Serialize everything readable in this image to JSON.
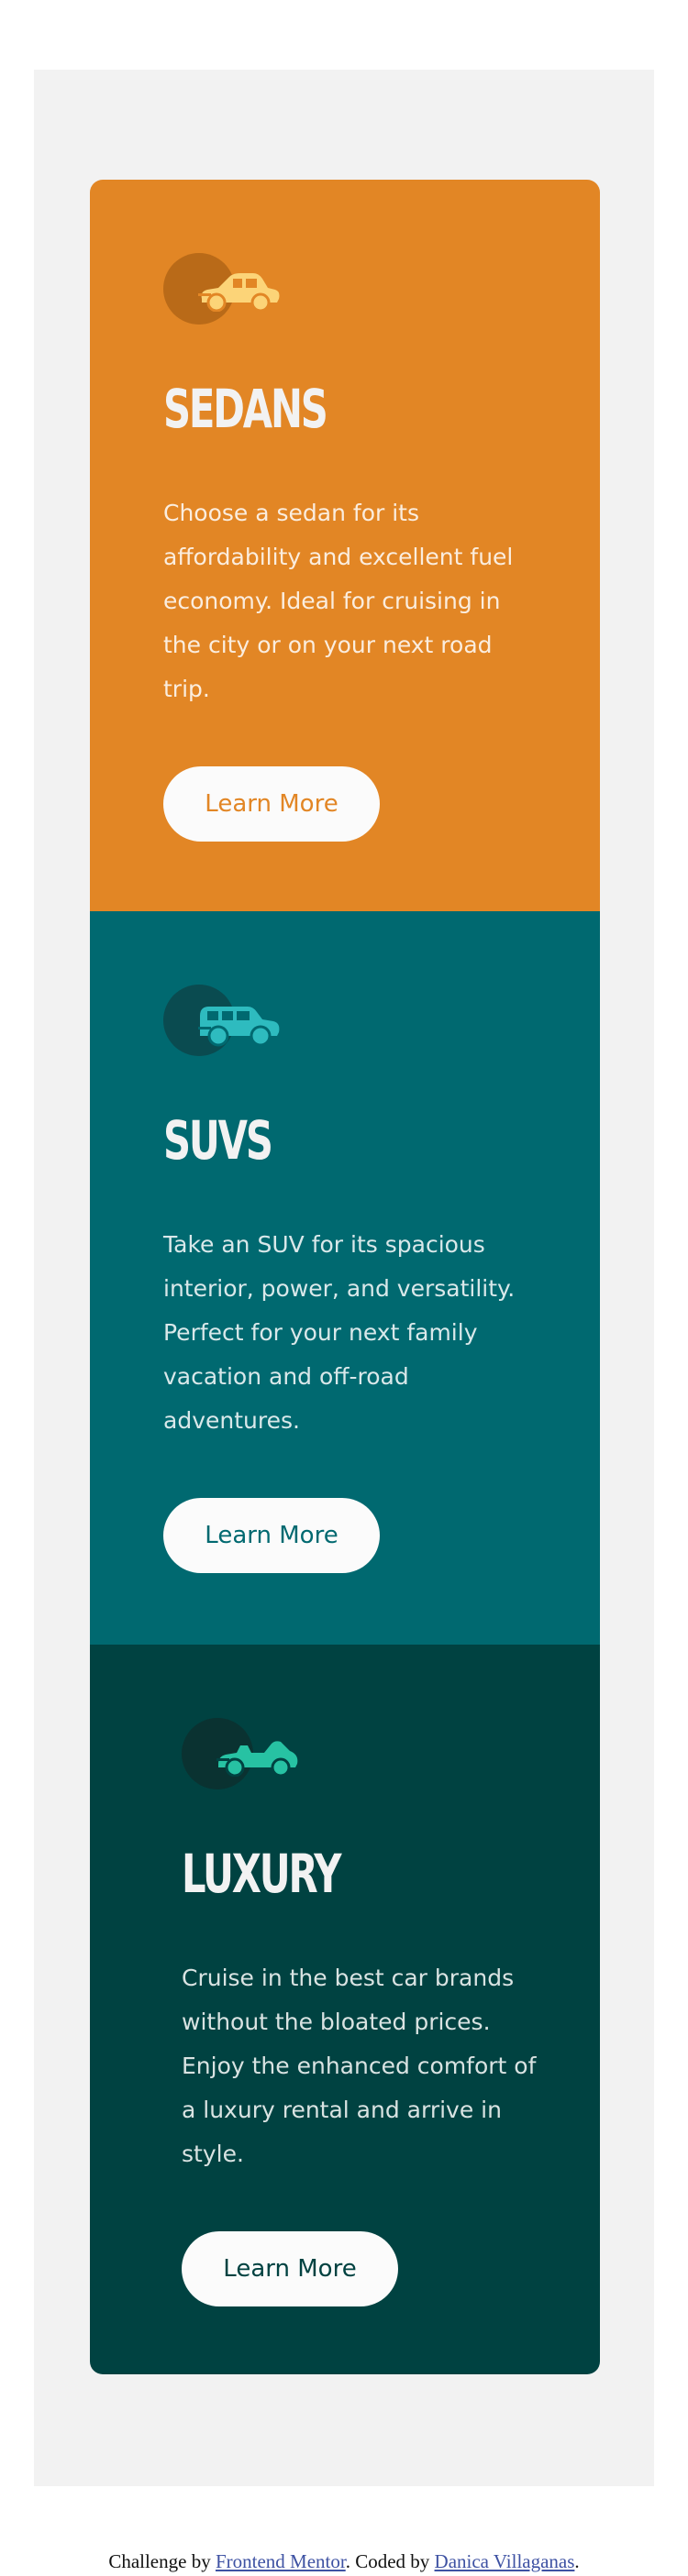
{
  "colors": {
    "sedans": "#e28625",
    "suvs": "#006970",
    "luxury": "#004241",
    "page_background": "#f2f2f2"
  },
  "cards": [
    {
      "icon": "sedan-car-icon",
      "title": "Sedans",
      "text": "Choose a sedan for its affordability and excellent fuel economy. Ideal for cruising in the city or on your next road trip.",
      "button_label": "Learn More"
    },
    {
      "icon": "suv-car-icon",
      "title": "SUVs",
      "text": "Take an SUV for its spacious interior, power, and versatility. Perfect for your next family vacation and off-road adventures.",
      "button_label": "Learn More"
    },
    {
      "icon": "luxury-car-icon",
      "title": "Luxury",
      "text": "Cruise in the best car brands without the bloated prices. Enjoy the enhanced comfort of a luxury rental and arrive in style.",
      "button_label": "Learn More"
    }
  ],
  "attribution": {
    "prefix": "Challenge by ",
    "link1": "Frontend Mentor",
    "middle": ". Coded by ",
    "link2": "Danica Villaganas",
    "suffix": "."
  }
}
